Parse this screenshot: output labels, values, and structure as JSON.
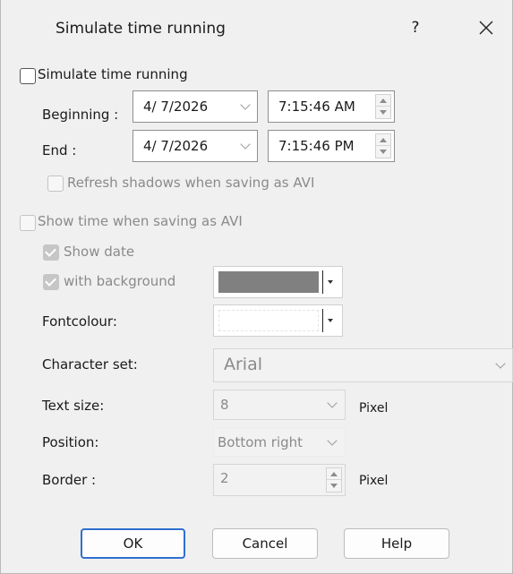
{
  "dialog": {
    "title": "Simulate time running",
    "help_label": "?",
    "close_icon": "close-icon"
  },
  "simulate": {
    "checkbox_label": "Simulate time running",
    "checked": false,
    "beginning_label": "Beginning :",
    "beginning_date": "4/ 7/2026",
    "beginning_time": "7:15:46 AM",
    "end_label": "End :",
    "end_date": "4/ 7/2026",
    "end_time": "7:15:46 PM",
    "refresh_label": "Refresh shadows when saving as AVI",
    "refresh_checked": false
  },
  "avi": {
    "show_time_label": "Show time when saving as AVI",
    "show_time_checked": false,
    "show_date_label": "Show date",
    "show_date_checked": true,
    "with_background_label": "with background",
    "with_background_checked": true,
    "background_color": "#808080",
    "fontcolour_label": "Fontcolour:",
    "fontcolour_color": "#ffffff",
    "charset_label": "Character set:",
    "charset_value": "Arial",
    "textsize_label": "Text size:",
    "textsize_value": "8",
    "textsize_unit": "Pixel",
    "position_label": "Position:",
    "position_value": "Bottom right",
    "border_label": "Border :",
    "border_value": "2",
    "border_unit": "Pixel"
  },
  "buttons": {
    "ok": "OK",
    "cancel": "Cancel",
    "help": "Help"
  },
  "colors": {
    "accent": "#2f6fd0",
    "window_bg": "#f0f0f0"
  }
}
